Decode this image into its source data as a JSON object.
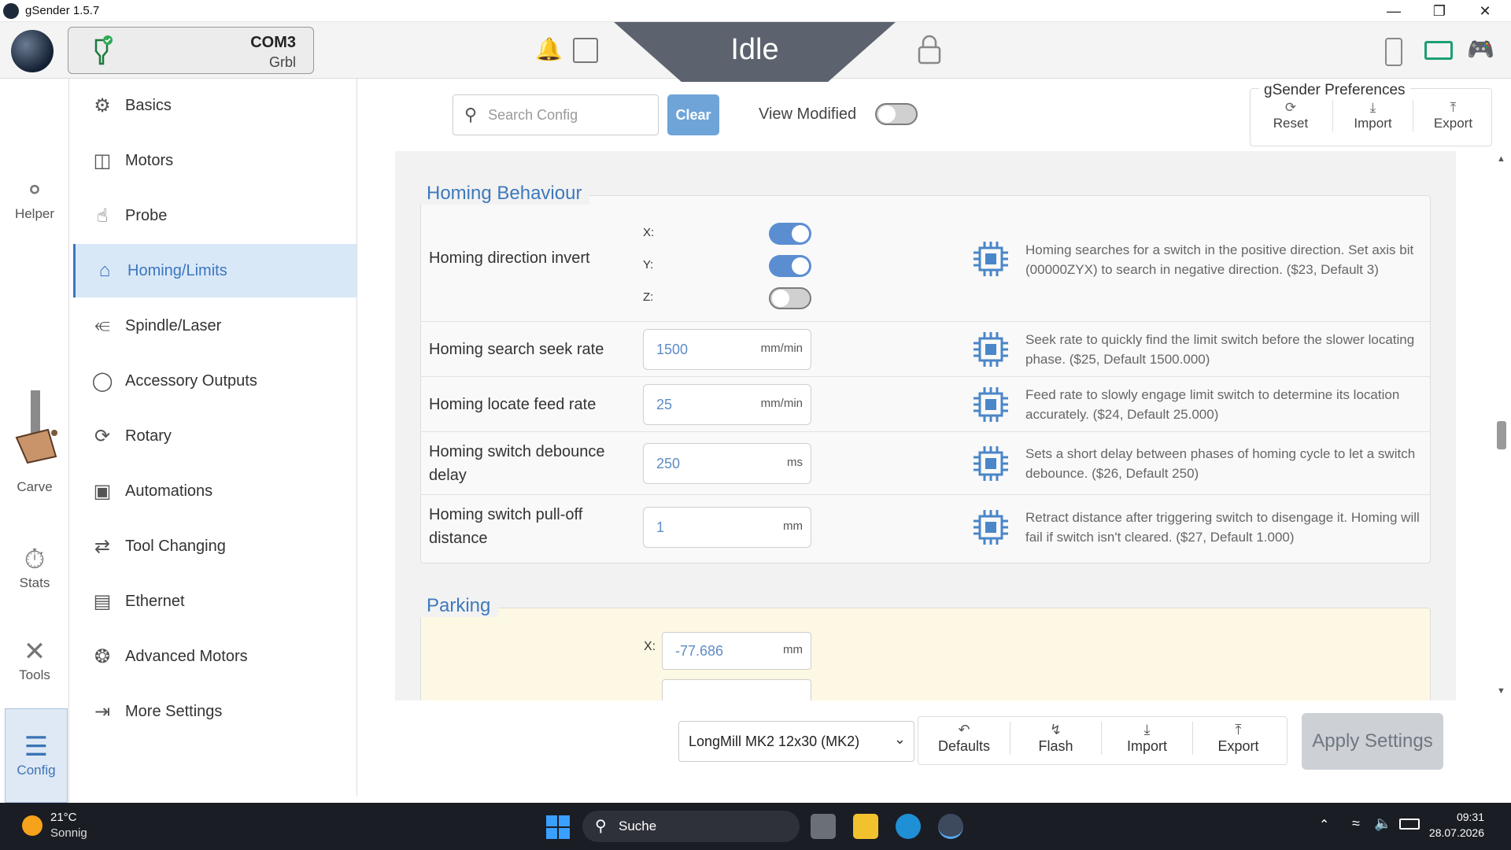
{
  "window": {
    "title": "gSender 1.5.7"
  },
  "header": {
    "port": "COM3",
    "firmware": "Grbl",
    "machine_state": "Idle"
  },
  "left_nav": [
    {
      "label": "Helper",
      "icon": "helper-icon"
    },
    {
      "label": "Carve",
      "icon": "carve-icon"
    },
    {
      "label": "Stats",
      "icon": "stats-icon"
    },
    {
      "label": "Tools",
      "icon": "tools-icon"
    },
    {
      "label": "Config",
      "icon": "config-icon",
      "active": true
    }
  ],
  "config_nav": [
    {
      "label": "Basics",
      "icon": "gear-icon"
    },
    {
      "label": "Motors",
      "icon": "motor-icon"
    },
    {
      "label": "Probe",
      "icon": "probe-icon"
    },
    {
      "label": "Homing/Limits",
      "icon": "home-icon",
      "active": true
    },
    {
      "label": "Spindle/Laser",
      "icon": "spindle-icon"
    },
    {
      "label": "Accessory Outputs",
      "icon": "lightbulb-icon"
    },
    {
      "label": "Rotary",
      "icon": "rotary-icon"
    },
    {
      "label": "Automations",
      "icon": "robot-icon"
    },
    {
      "label": "Tool Changing",
      "icon": "swap-arrows-icon"
    },
    {
      "label": "Ethernet",
      "icon": "ethernet-icon"
    },
    {
      "label": "Advanced Motors",
      "icon": "advanced-motor-icon"
    },
    {
      "label": "More Settings",
      "icon": "list-icon"
    }
  ],
  "toolbar": {
    "search_placeholder": "Search Config",
    "clear_label": "Clear",
    "view_modified_label": "View Modified",
    "view_modified_on": false
  },
  "preferences": {
    "title": "gSender Preferences",
    "reset": "Reset",
    "import": "Import",
    "export": "Export"
  },
  "homing": {
    "title": "Homing Behaviour",
    "direction_invert": {
      "label": "Homing direction invert",
      "axes": [
        {
          "axis": "X:",
          "on": true
        },
        {
          "axis": "Y:",
          "on": true
        },
        {
          "axis": "Z:",
          "on": false
        }
      ],
      "desc": "Homing searches for a switch in the positive direction. Set axis bit (00000ZYX) to search in negative direction. ($23, Default 3)"
    },
    "seek_rate": {
      "label": "Homing search seek rate",
      "value": "1500",
      "unit": "mm/min",
      "desc": "Seek rate to quickly find the limit switch before the slower locating phase. ($25, Default 1500.000)"
    },
    "feed_rate": {
      "label": "Homing locate feed rate",
      "value": "25",
      "unit": "mm/min",
      "desc": "Feed rate to slowly engage limit switch to determine its location accurately. ($24, Default 25.000)"
    },
    "debounce": {
      "label_line1": "Homing switch debounce",
      "label_line2": "delay",
      "value": "250",
      "unit": "ms",
      "desc": "Sets a short delay between phases of homing cycle to let a switch debounce. ($26, Default 250)"
    },
    "pulloff": {
      "label_line1": "Homing switch pull-off",
      "label_line2": "distance",
      "value": "1",
      "unit": "mm",
      "desc": "Retract distance after triggering switch to disengage it. Homing will fail if switch isn't cleared. ($27, Default 1.000)"
    }
  },
  "parking": {
    "title": "Parking",
    "x_label": "X:",
    "x_value": "-77.686",
    "x_unit": "mm"
  },
  "bottom": {
    "profile": "LongMill MK2 12x30 (MK2)",
    "defaults": "Defaults",
    "flash": "Flash",
    "import": "Import",
    "export": "Export",
    "apply": "Apply Settings"
  },
  "taskbar": {
    "temp": "21°C",
    "condition": "Sonnig",
    "search": "Suche",
    "time": "09:31",
    "date": "28.07.2026"
  },
  "colors": {
    "accent": "#3a76c0",
    "state_bg": "#5c636e",
    "toggle_on": "#5b8ed1",
    "parking_bg": "#fdf8e3"
  }
}
